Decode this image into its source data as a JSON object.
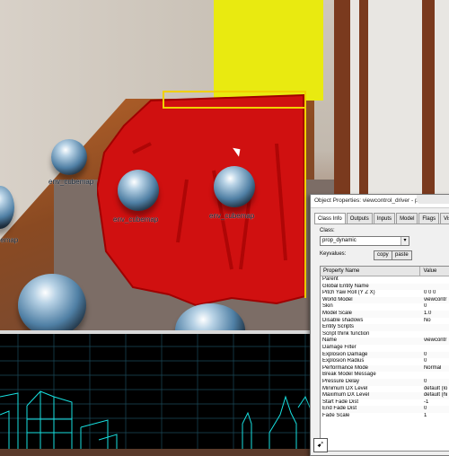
{
  "viewport": {
    "sphere_labels": [
      "env_cubemap",
      "env_cubemap",
      "env_cubemap",
      "env_cubemap"
    ]
  },
  "dialog": {
    "title": "Object Properties: viewcontrol_driver - prop_dynamic",
    "tabs": [
      "Class Info",
      "Outputs",
      "Inputs",
      "Model",
      "Flags",
      "VisGroup"
    ],
    "class_label": "Class:",
    "class_value": "prop_dynamic",
    "keyvalues_label": "Keyvalues:",
    "copy_button": "copy",
    "paste_button": "paste",
    "columns": [
      "Property Name",
      "Value"
    ],
    "rows": [
      {
        "name": "Parent",
        "value": ""
      },
      {
        "name": "Global Entity Name",
        "value": ""
      },
      {
        "name": "Pitch Yaw Roll (Y Z X)",
        "value": "0 0 0"
      },
      {
        "name": "World Model",
        "value": "viewcontr"
      },
      {
        "name": "Skin",
        "value": "0"
      },
      {
        "name": "Model Scale",
        "value": "1.0"
      },
      {
        "name": "Disable shadows",
        "value": "No"
      },
      {
        "name": "Entity Scripts",
        "value": ""
      },
      {
        "name": "Script think function",
        "value": ""
      },
      {
        "name": "Name",
        "value": "viewcontr"
      },
      {
        "name": "Damage Filter",
        "value": ""
      },
      {
        "name": "Explosion Damage",
        "value": "0"
      },
      {
        "name": "Explosion Radius",
        "value": "0"
      },
      {
        "name": "Performance Mode",
        "value": "Normal"
      },
      {
        "name": "Break Model Message",
        "value": ""
      },
      {
        "name": "Pressure Delay",
        "value": "0"
      },
      {
        "name": "Minimum DX Level",
        "value": "default (lo"
      },
      {
        "name": "Maximum DX Level",
        "value": "default (hi"
      },
      {
        "name": "Start Fade Dist",
        "value": "-1"
      },
      {
        "name": "End Fade Dist",
        "value": "0"
      },
      {
        "name": "Fade Scale",
        "value": "1"
      }
    ],
    "pick_icon": "eyedropper-icon"
  }
}
